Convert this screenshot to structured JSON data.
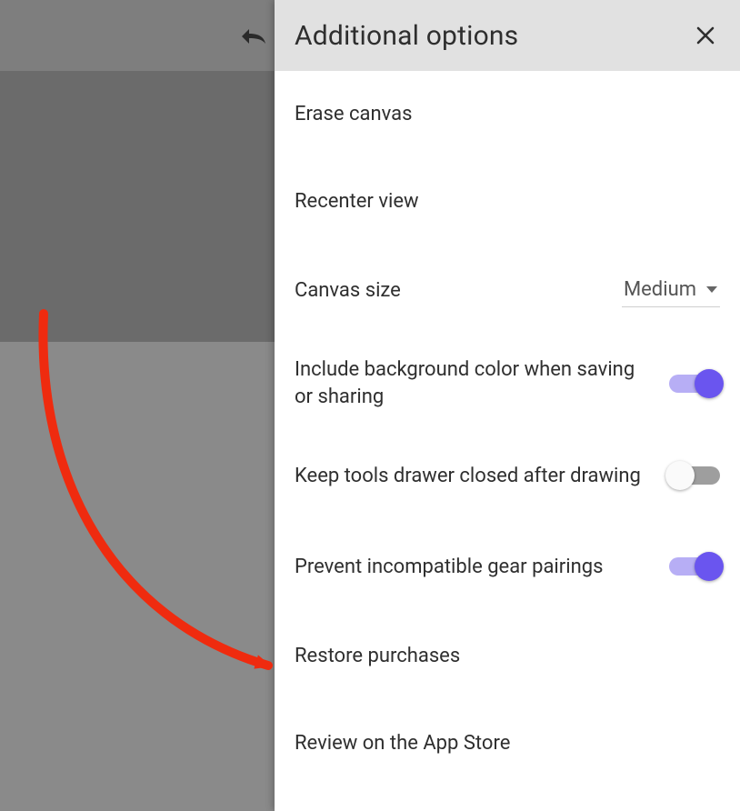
{
  "panel": {
    "title": "Additional options",
    "items": {
      "erase_canvas": "Erase canvas",
      "recenter_view": "Recenter view",
      "canvas_size_label": "Canvas size",
      "canvas_size_value": "Medium",
      "include_bg_label": "Include background color when saving or sharing",
      "include_bg_on": true,
      "keep_tools_label": "Keep tools drawer closed after drawing",
      "keep_tools_on": false,
      "prevent_pairings_label": "Prevent incompatible gear pairings",
      "prevent_pairings_on": true,
      "restore_purchases": "Restore purchases",
      "review_app_store": "Review on the App Store"
    }
  },
  "annotation": {
    "target": "restore-purchases",
    "color": "#ef2b0f"
  }
}
